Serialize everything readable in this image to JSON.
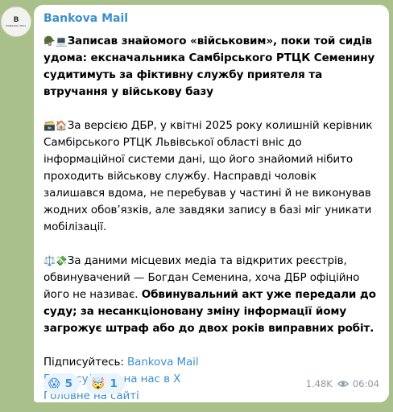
{
  "channel": {
    "name": "Bankova Mail",
    "avatar_monogram": "B",
    "avatar_caption": "BANKOVA MAIL"
  },
  "post": {
    "p1_emoji": "🪖💻",
    "p1_text": "Записав знайомого «військовим», поки той сидів удома: ексначальника Самбірського РТЦК Семенину судитимуть за фіктивну службу приятеля та втручання у військову базу",
    "p2_emoji": "🗃️🏠",
    "p2_text": "За версією ДБР, у квітні 2025 року колишній керівник Самбірського РТЦК Львівської області вніс до інформаційної системи дані, що його знайомий нібито проходить військову службу. Насправді чоловік залишався вдома, не перебував у частині й не виконував жодних обов’язків, але завдяки запису в базі міг уникати мобілізації.",
    "p3_emoji": "⚖️💸",
    "p3_text": "За даними місцевих медіа та відкритих реєстрів, обвинувачений — Богдан Семенина, хоча ДБР офіційно його не називає. ",
    "p3_bold": "Обвинувальний акт уже передали до суду; за несанкціоновану зміну інформації йому загрожує штраф або до двох років виправних робіт."
  },
  "links": {
    "subscribe_label": "Підписуйтесь: ",
    "subscribe_link": "Bankova Mail",
    "x_link": "Підписуйтесь на нас в Х",
    "site_link": "Головне на сайті"
  },
  "reactions": [
    {
      "emoji": "😱",
      "count": "5"
    },
    {
      "emoji": "🤯",
      "count": "1"
    }
  ],
  "meta": {
    "views": "1.48K",
    "time": "06:04",
    "icon": "eye-icon"
  },
  "colors": {
    "link": "#3d8fcc",
    "background": "#a9c08a",
    "reaction_bg": "#e9f4fc"
  }
}
